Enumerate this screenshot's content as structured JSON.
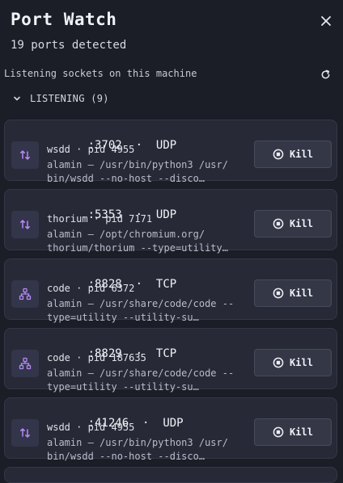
{
  "header": {
    "title": "Port Watch",
    "subtitle": "19 ports detected"
  },
  "section": {
    "label": "Listening sockets on this machine"
  },
  "group": {
    "label": "LISTENING (9)",
    "expanded": true
  },
  "kill_label": "Kill",
  "accent": "#b78af7",
  "ports": [
    {
      "port": ":3702",
      "protocol": "UDP",
      "proc": "wsdd · pid 4955",
      "cmd1": "alamin — /usr/bin/python3 /usr/",
      "cmd2": "bin/wsdd --no-host --disco…",
      "icon": "arrows-updown-icon"
    },
    {
      "port": ":5353",
      "protocol": "UDP",
      "proc": "thorium · pid 7171",
      "cmd1": "alamin — /opt/chromium.org/",
      "cmd2": "thorium/thorium --type=utility…",
      "icon": "arrows-updown-icon"
    },
    {
      "port": ":8828",
      "protocol": "TCP",
      "proc": "code · pid 6372",
      "cmd1": "alamin — /usr/share/code/code --",
      "cmd2": "type=utility --utility-su…",
      "icon": "network-icon"
    },
    {
      "port": ":8829",
      "protocol": "TCP",
      "proc": "code · pid 187635",
      "cmd1": "alamin — /usr/share/code/code --",
      "cmd2": "type=utility --utility-su…",
      "icon": "network-icon"
    },
    {
      "port": ":41246",
      "protocol": "UDP",
      "proc": "wsdd · pid 4955",
      "cmd1": "alamin — /usr/bin/python3 /usr/",
      "cmd2": "bin/wsdd --no-host --disco…",
      "icon": "arrows-updown-icon"
    }
  ]
}
